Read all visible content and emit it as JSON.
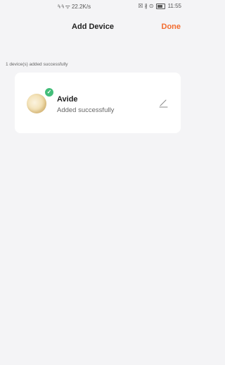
{
  "status_bar": {
    "signal_left": "ᵃᵢᵢ",
    "signal_right": "ᵃᵢᵢ",
    "wifi": "ᯤ",
    "speed": "22.2K/s",
    "icons_right": "☒ ∦ ⊙",
    "time": "11:55"
  },
  "nav": {
    "title": "Add Device",
    "done_label": "Done"
  },
  "summary": {
    "text": "1 device(s) added successfully"
  },
  "device": {
    "name": "Avide",
    "status": "Added successfully",
    "check_glyph": "✓",
    "icons": [
      "check-icon",
      "edit-pencil-icon"
    ]
  },
  "colors": {
    "accent": "#f26b2e",
    "success": "#43bd79",
    "background": "#f4f4f6"
  }
}
